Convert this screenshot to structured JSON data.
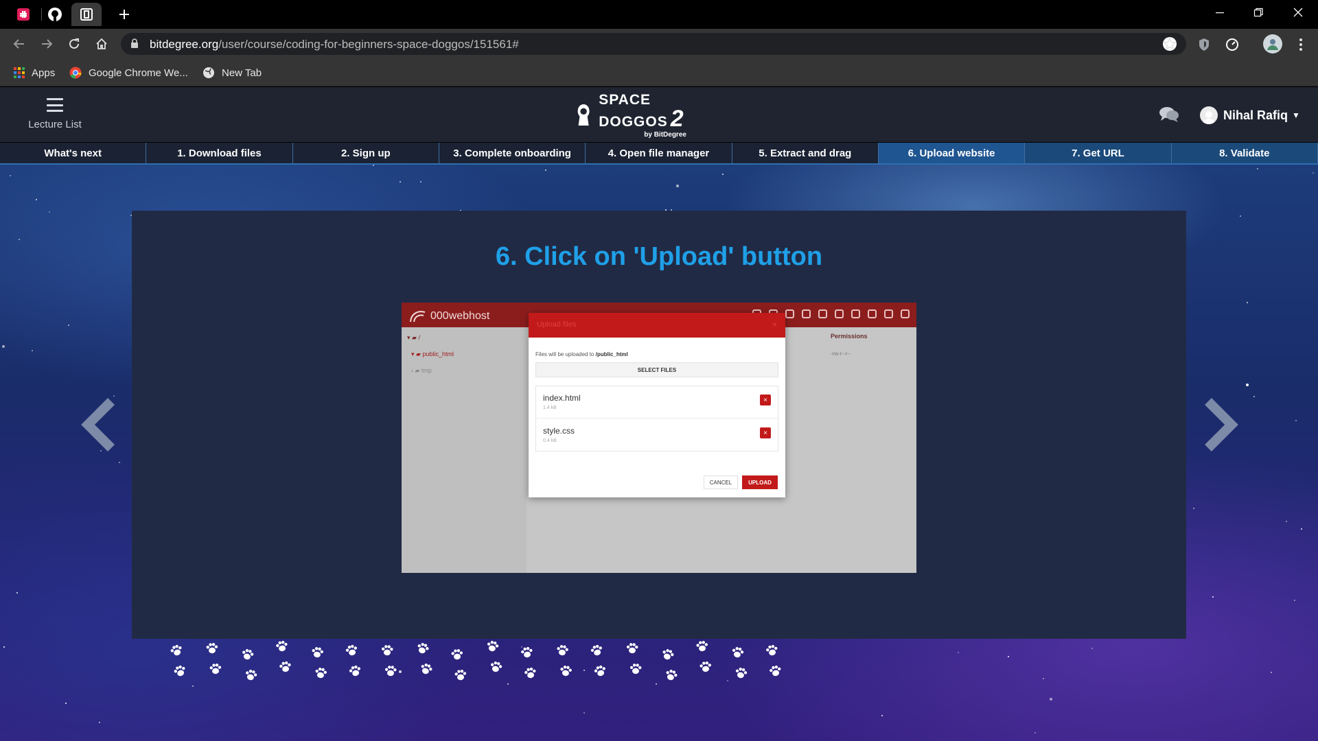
{
  "browser": {
    "tabs": [
      {
        "icon": "slack-icon",
        "active": false
      },
      {
        "icon": "github-icon",
        "active": false
      },
      {
        "icon": "bitdegree-icon",
        "active": true
      }
    ],
    "url_host": "bitdegree.org",
    "url_path": "/user/course/coding-for-beginners-space-doggos/151561#",
    "bookmarks": [
      {
        "label": "Apps",
        "icon": "apps-grid-icon"
      },
      {
        "label": "Google Chrome We...",
        "icon": "chrome-icon"
      },
      {
        "label": "New Tab",
        "icon": "globe-icon"
      }
    ]
  },
  "site": {
    "lecture_list_label": "Lecture List",
    "logo_main": "SPACE DOGGOS",
    "logo_number": "2",
    "logo_by": "by BitDegree",
    "user_name": "Nihal Rafiq"
  },
  "steps": [
    {
      "label": "What's next",
      "state": "past"
    },
    {
      "label": "1. Download files",
      "state": "past"
    },
    {
      "label": "2. Sign up",
      "state": "past"
    },
    {
      "label": "3. Complete onboarding",
      "state": "past"
    },
    {
      "label": "4. Open file manager",
      "state": "past"
    },
    {
      "label": "5. Extract and drag",
      "state": "past"
    },
    {
      "label": "6. Upload website",
      "state": "current"
    },
    {
      "label": "7. Get URL",
      "state": "future"
    },
    {
      "label": "8. Validate",
      "state": "future"
    }
  ],
  "content": {
    "title": "6. Click on 'Upload' button",
    "screenshot": {
      "brand": "000webhost",
      "tree_root": "/",
      "tree_folder_1": "public_html",
      "tree_folder_2": "tmp",
      "permissions_header": "Permissions",
      "permissions_value": "-rw-r--r--",
      "dialog_title": "Upload files",
      "dialog_close": "×",
      "note_prefix": "Files will be uploaded to ",
      "note_path": "/public_html",
      "select_files": "SELECT FILES",
      "files": [
        {
          "name": "index.html",
          "size": "1.4 kB"
        },
        {
          "name": "style.css",
          "size": "0.4 kB"
        }
      ],
      "delete_glyph": "×",
      "cancel_label": "CANCEL",
      "upload_label": "UPLOAD"
    }
  },
  "colors": {
    "accent_title": "#1fa0e8",
    "webhost_red": "#c21a1a",
    "step_current": "#1f5590"
  }
}
